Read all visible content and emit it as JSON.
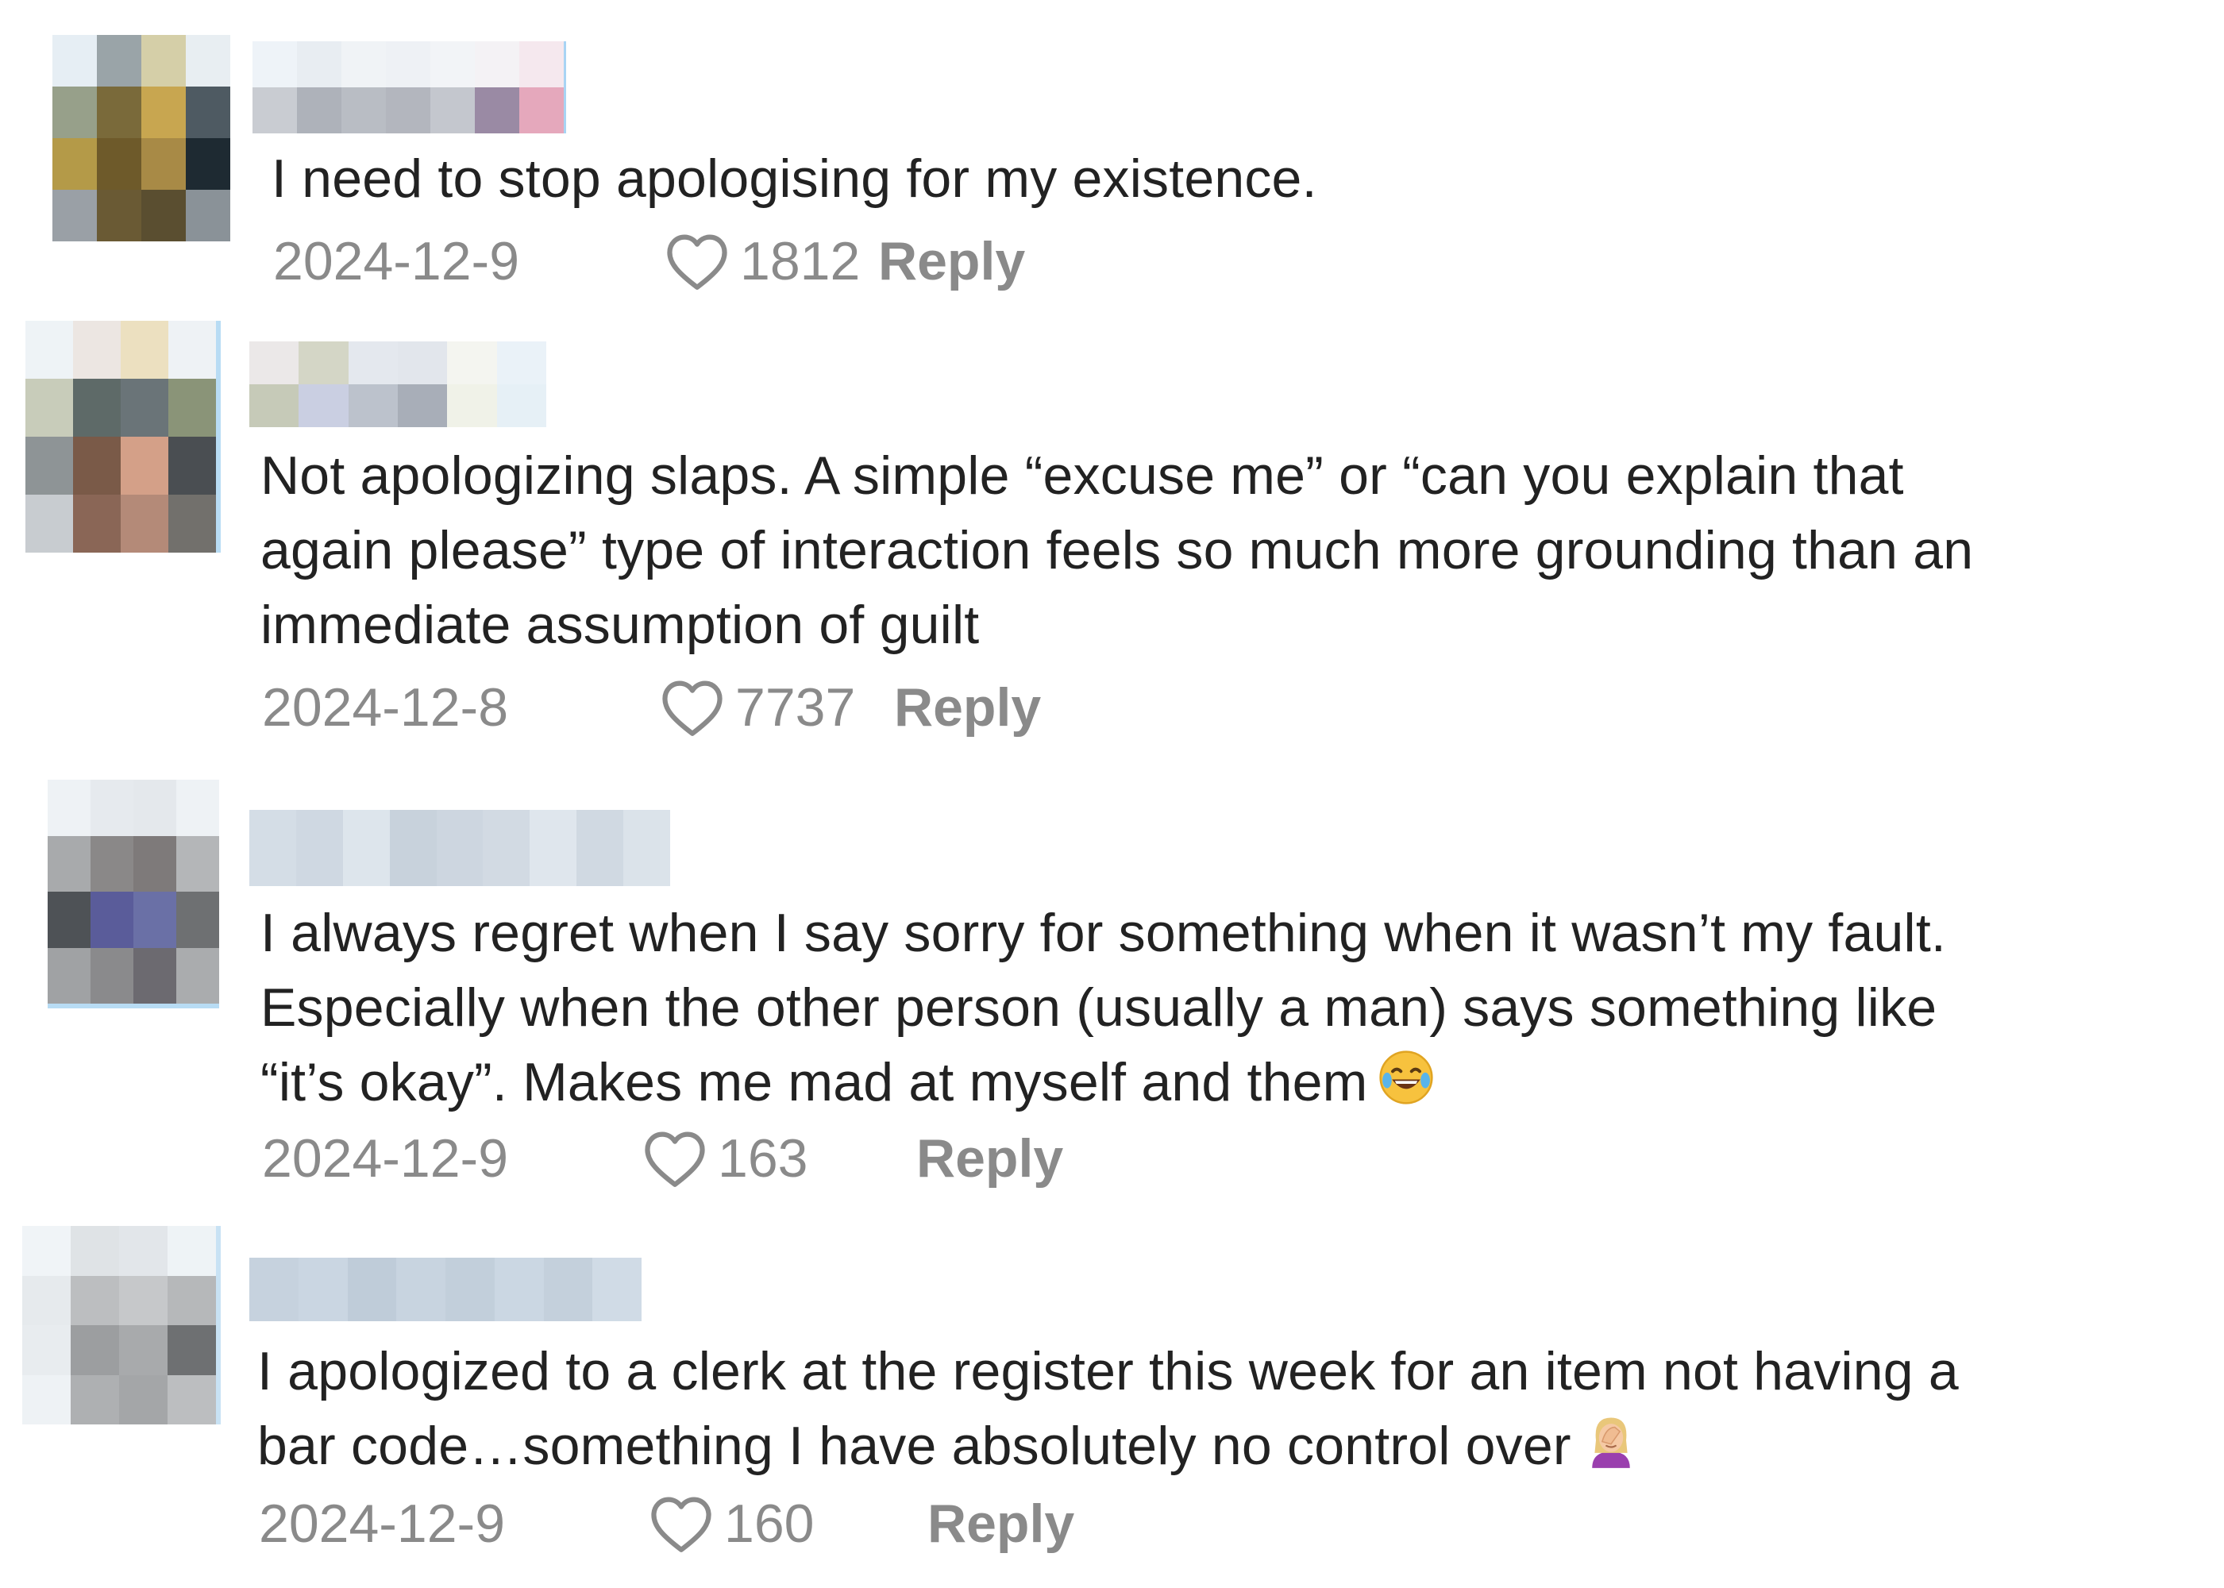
{
  "comments": [
    {
      "text": "I need to stop apologising for my existence.",
      "date": "2024-12-9",
      "likes": "1812",
      "reply_label": "Reply"
    },
    {
      "text": "Not apologizing slaps. A simple “excuse me” or “can you explain that\nagain please” type of interaction feels so much more grounding than an\nimmediate assumption of guilt",
      "date": "2024-12-8",
      "likes": "7737",
      "reply_label": "Reply"
    },
    {
      "text": "I always regret when I say sorry for something when it wasn’t my fault.\nEspecially when the other person (usually a man) says something like\n“it’s okay”. Makes me mad at myself and them",
      "date": "2024-12-9",
      "likes": "163",
      "reply_label": "Reply",
      "emoji": "tears-of-joy-emoji"
    },
    {
      "text": "I apologized to a clerk at the register this week for an item not having a\nbar code…something I have absolutely no control over",
      "date": "2024-12-9",
      "likes": "160",
      "reply_label": "Reply",
      "emoji": "woman-facepalming-emoji"
    }
  ],
  "icons": {
    "like": "heart-outline-icon"
  },
  "colors": {
    "text": "#222222",
    "meta": "#8a8a8a"
  }
}
